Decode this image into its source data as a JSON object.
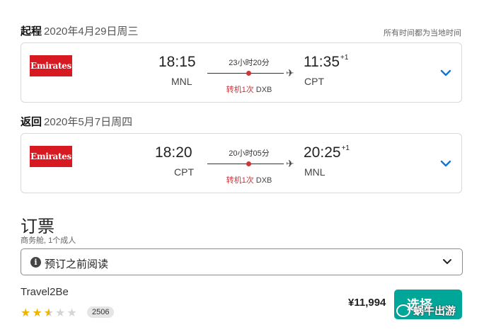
{
  "outbound": {
    "label": "起程",
    "date": "2020年4月29日周三",
    "airline": "Emirates",
    "depart_time": "18:15",
    "depart_code": "MNL",
    "duration": "23小时20分",
    "stops": "转机1次",
    "via": "DXB",
    "arrive_time": "11:35",
    "arrive_offset": "+1",
    "arrive_code": "CPT"
  },
  "timezone_note": "所有时间都为当地时间",
  "return": {
    "label": "返回",
    "date": "2020年5月7日周四",
    "airline": "Emirates",
    "depart_time": "18:20",
    "depart_code": "CPT",
    "duration": "20小时05分",
    "stops": "转机1次",
    "via": "DXB",
    "arrive_time": "20:25",
    "arrive_offset": "+1",
    "arrive_code": "MNL"
  },
  "booking": {
    "title": "订票",
    "subtitle": "商务舱, 1个成人",
    "notice": "预订之前阅读",
    "agency": "Travel2Be",
    "rating": 2.5,
    "reviews": "2506",
    "price": "¥11,994",
    "select_label": "选择"
  },
  "watermark": "蜗牛出游",
  "colors": {
    "accent": "#00a698",
    "stop_red": "#c8373b",
    "chevron_blue": "#1573d2",
    "emirates_red": "#d71921"
  }
}
